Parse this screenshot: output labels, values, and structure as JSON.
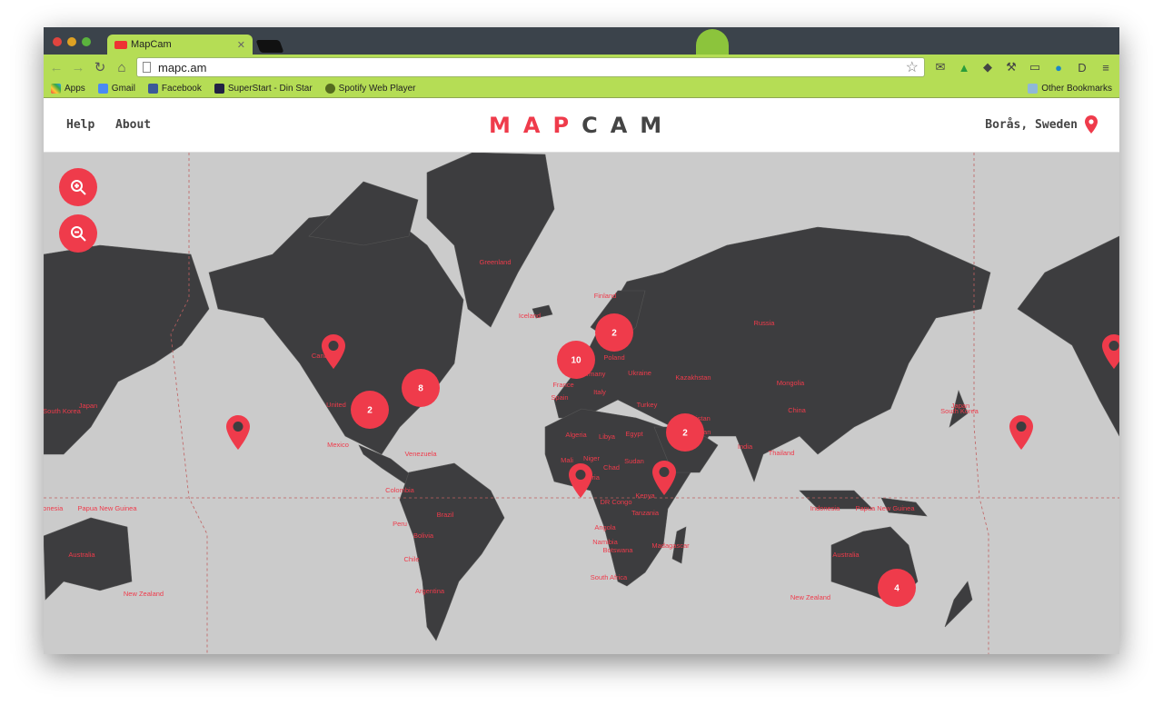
{
  "browser": {
    "tab_title": "MapCam",
    "url": "mapc.am",
    "bookmarks": [
      "Apps",
      "Gmail",
      "Facebook",
      "SuperStart - Din Star",
      "Spotify Web Player"
    ],
    "other_bookmarks": "Other Bookmarks"
  },
  "header": {
    "nav": [
      "Help",
      "About"
    ],
    "logo": "MAPCAM",
    "location": "Borås, Sweden"
  },
  "colors": {
    "accent": "#ef3b4b",
    "land": "#3d3d3f",
    "water": "#cbcbcb",
    "toolbar": "#b5dd55"
  },
  "map": {
    "zoom_controls": [
      {
        "icon": "zoom-in-icon"
      },
      {
        "icon": "zoom-out-icon"
      }
    ],
    "clusters": [
      {
        "count": "2"
      },
      {
        "count": "10"
      },
      {
        "count": "8"
      },
      {
        "count": "2"
      },
      {
        "count": "2"
      },
      {
        "count": "4"
      }
    ],
    "pin_count": 6,
    "country_labels": [
      "Greenland",
      "Iceland",
      "Finland",
      "Russia",
      "Canada",
      "Poland",
      "Germany",
      "Ukraine",
      "France",
      "Spain",
      "Italy",
      "Turkey",
      "Kazakhstan",
      "Mongolia",
      "China",
      "Afghanistan",
      "Pakistan",
      "India",
      "Thailand",
      "Algeria",
      "Libya",
      "Egypt",
      "Mali",
      "Niger",
      "Chad",
      "Sudan",
      "Nigeria",
      "Kenya",
      "DR Congo",
      "Tanzania",
      "Angola",
      "Namibia",
      "Botswana",
      "Madagascar",
      "South Africa",
      "Mexico",
      "United",
      "Venezuela",
      "Colombia",
      "Peru",
      "Brazil",
      "Bolivia",
      "Chile",
      "Argentina",
      "Australia",
      "New Zealand",
      "Indonesia",
      "Papua New Guinea",
      "Japan",
      "South Korea",
      "Australia",
      "New Zealand",
      "Japan",
      "South Korea",
      "Indonesia",
      "Papua New Guinea"
    ]
  }
}
